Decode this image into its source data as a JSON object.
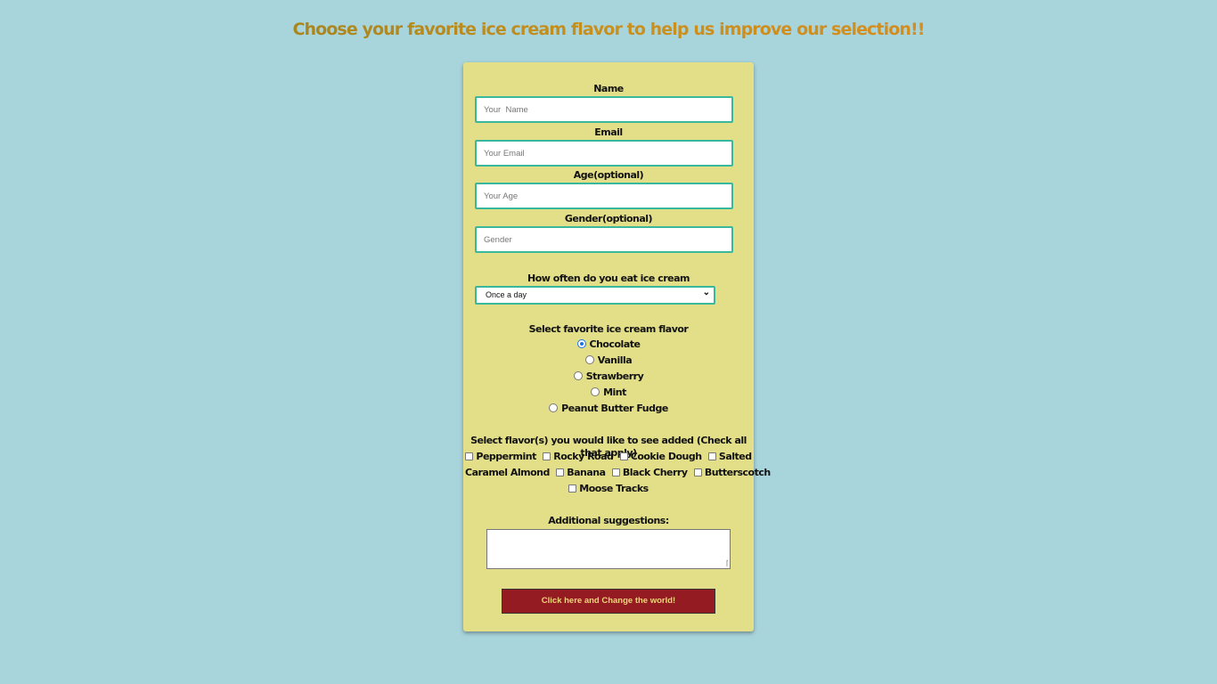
{
  "header": {
    "title": "Choose your favorite ice cream flavor to help us improve our selection!!"
  },
  "form": {
    "name_label": "Name",
    "name_placeholder": "Your  Name",
    "email_label": "Email",
    "email_placeholder": "Your Email",
    "age_label": "Age(optional)",
    "age_placeholder": "Your Age",
    "gender_label": "Gender(optional)",
    "gender_placeholder": "Gender",
    "frequency_label": "How often do you eat ice cream",
    "frequency_selected": "Once a day",
    "favorite_label": "Select favorite ice cream flavor",
    "favorite_options": [
      "Chocolate",
      "Vanilla",
      "Strawberry",
      "Mint",
      "Peanut Butter Fudge"
    ],
    "favorite_selected": "Chocolate",
    "added_label": "Select flavor(s) you would like to see added (Check all that apply)",
    "added_options": [
      "Peppermint",
      "Rocky Road",
      "Cookie Dough",
      "Salted Caramel Almond",
      "Banana",
      "Black Cherry",
      "Butterscotch",
      "Moose Tracks"
    ],
    "suggestions_label": "Additional suggestions:",
    "submit_label": "Click here and Change the world!"
  }
}
